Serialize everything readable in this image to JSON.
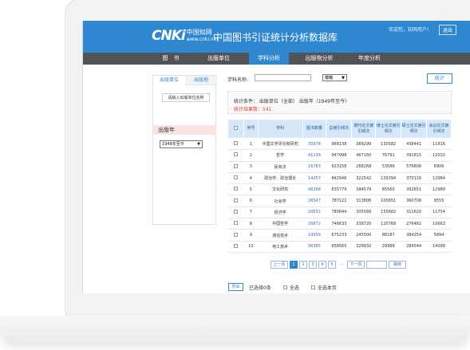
{
  "header": {
    "logo_mark": "CNKi",
    "logo_cn": "中国知网",
    "logo_url": "www.cnki.net",
    "title": "中国图书引证统计分析数据库",
    "welcome": "欢迎您，知网用户!",
    "logout": "退出"
  },
  "nav": {
    "items": [
      "图　书",
      "出版单位",
      "学科分析",
      "出版物分析",
      "年度分析"
    ],
    "active_index": 2
  },
  "left_panel": {
    "tabs": [
      "出版单位",
      "出版地"
    ],
    "pub_button": "请输入出版单位名称",
    "year_title": "出版年",
    "year_value": "1949年至今"
  },
  "search": {
    "label": "学科名称:",
    "input_value": "",
    "match_value": "模糊",
    "stat_button": "统计"
  },
  "conditions": {
    "line": "统计条件： 出版单位（全部）   出版年（1949年至今）",
    "count": "统计结果数：541"
  },
  "table": {
    "headers": [
      "",
      "序号",
      "学科",
      "图书数量",
      "总被引频次",
      "期刊论文被引频次",
      "博士论文被引频次",
      "硕士论文被引频次",
      "会议论文被引频次"
    ],
    "rows": [
      [
        "1",
        "中国文学评论和研究",
        "35978",
        "968138",
        "389299",
        "130582",
        "438441",
        "11816"
      ],
      [
        "2",
        "哲学",
        "41139",
        "947998",
        "467160",
        "76791",
        "391815",
        "12032"
      ],
      [
        "3",
        "民商法",
        "16783",
        "923158",
        "288268",
        "53586",
        "576806",
        "6906"
      ],
      [
        "4",
        "政治学、政治理论",
        "14357",
        "842946",
        "322542",
        "139394",
        "370116",
        "12984"
      ],
      [
        "5",
        "文化研究",
        "46268",
        "835779",
        "344579",
        "85560",
        "392651",
        "12989"
      ],
      [
        "6",
        "社会学",
        "26547",
        "787122",
        "313806",
        "100651",
        "360708",
        "9555"
      ],
      [
        "7",
        "经济学",
        "20631",
        "780644",
        "305566",
        "155682",
        "311620",
        "11754"
      ],
      [
        "8",
        "中国哲学",
        "26872",
        "746633",
        "338720",
        "120768",
        "276482",
        "10663"
      ],
      [
        "9",
        "通信技术",
        "19959",
        "675233",
        "245500",
        "88187",
        "384254",
        "5894"
      ],
      [
        "10",
        "电工技术",
        "36385",
        "658565",
        "329932",
        "29988",
        "284544",
        "14099"
      ]
    ]
  },
  "pagination": {
    "prev": "上一页",
    "pages": [
      "1",
      "2",
      "3",
      "4",
      "5"
    ],
    "ellipsis": "...",
    "next": "下一页",
    "go": "跳转"
  },
  "footer": {
    "export": "导出",
    "selected": "已选择0条",
    "select_all": "全选",
    "select_page": "全选本页"
  },
  "colors": {
    "header_blue": "#2f87d0",
    "nav_dark": "#505457",
    "count_red": "#e0392b"
  }
}
